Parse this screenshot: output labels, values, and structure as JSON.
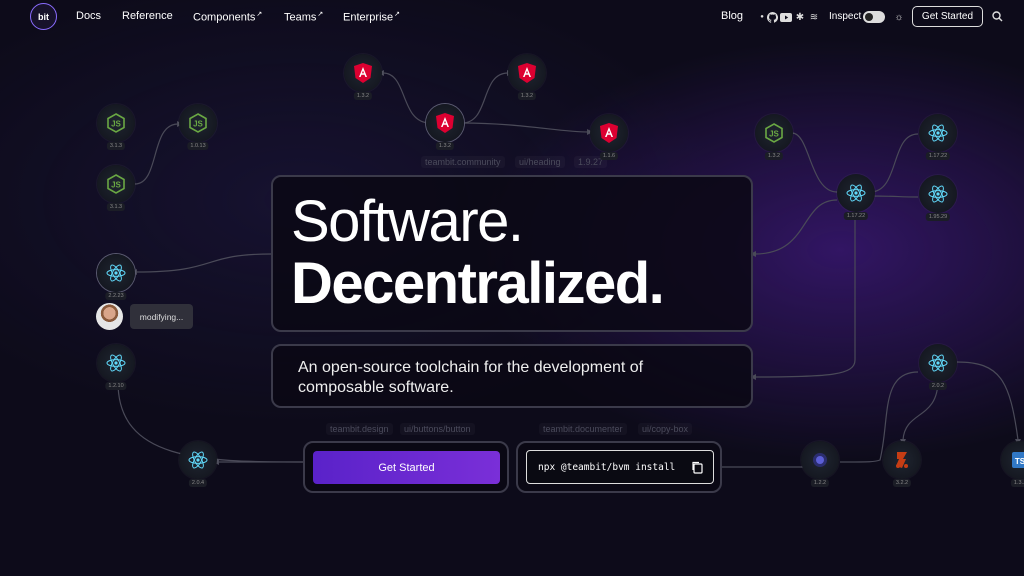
{
  "nav": {
    "logo_text": "bit",
    "links": [
      "Docs",
      "Reference",
      "Components",
      "Teams",
      "Enterprise"
    ],
    "blog": "Blog",
    "inspect": "Inspect",
    "get_started": "Get Started"
  },
  "hero": {
    "line1": "Software.",
    "line2": "Decentralized.",
    "subtitle": "An open-source toolchain for the development of composable software.",
    "cta": "Get Started",
    "command": "npx @teambit/bvm install"
  },
  "labels": {
    "top_scope": "teambit.community",
    "top_path": "ui/heading",
    "top_ver": "1.9.27",
    "left_scope": "teambit.design",
    "left_path": "ui/buttons/button",
    "right_scope": "teambit.documenter",
    "right_path": "ui/copy-box"
  },
  "presence": {
    "status": "modifying..."
  },
  "nodes": {
    "angular": [
      "1.3.2",
      "1.3.2",
      "1.3.2",
      "1.1.6"
    ],
    "node": [
      "3.1.3",
      "1.0.13",
      "3.1.3",
      "1.3.2"
    ],
    "react": [
      "1.17.22",
      "1.17.22",
      "1.95.29",
      "2.2.23",
      "1.2.10",
      "2.0.4",
      "2.0.2"
    ],
    "other": [
      "1.2.2",
      "3.2.2",
      "1.3..."
    ]
  },
  "colors": {
    "accent": "#6a28d0",
    "angular": "#dd0031",
    "node": "#6aa843",
    "react": "#61dafb"
  }
}
